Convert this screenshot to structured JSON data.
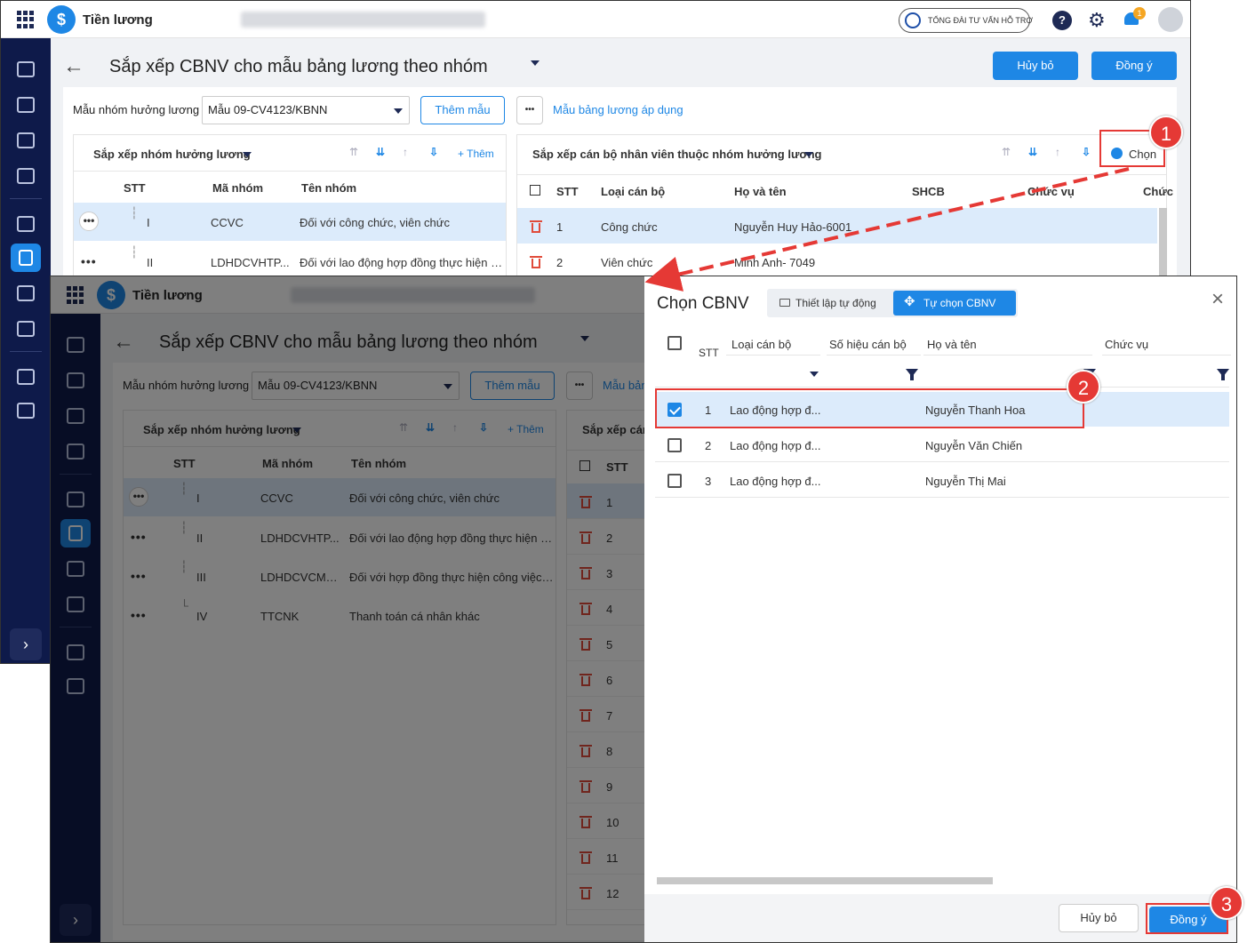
{
  "app": {
    "name": "Tiền lương",
    "support": "TỔNG ĐÀI TƯ VẤN HỖ TRỢ",
    "notification_count": "1"
  },
  "page": {
    "title": "Sắp xếp CBNV cho mẫu bảng lương theo nhóm",
    "cancel": "Hủy bỏ",
    "confirm": "Đồng ý"
  },
  "toolbar": {
    "template_label": "Mẫu nhóm hưởng lương",
    "template_value": "Mẫu 09-CV4123/KBNN",
    "add_template": "Thêm mẫu",
    "more": "•••",
    "applied_link": "Mẫu bảng lương áp dụng"
  },
  "groups": {
    "title": "Sắp xếp nhóm hưởng lương",
    "add": "+ Thêm",
    "columns": [
      "STT",
      "Mã nhóm",
      "Tên nhóm"
    ],
    "rows": [
      {
        "stt": "I",
        "code": "CCVC",
        "name": "Đối với công chức, viên chức"
      },
      {
        "stt": "II",
        "code": "LDHDCVHTP...",
        "name": "Đối với lao động hợp đồng thực hiện c..."
      },
      {
        "stt": "III",
        "code": "LDHDCVCMN...",
        "name": "Đối với hợp đồng thực hiện công việc ..."
      },
      {
        "stt": "IV",
        "code": "TTCNK",
        "name": "Thanh toán cá nhân khác"
      }
    ]
  },
  "staff": {
    "title": "Sắp xếp cán bộ nhân viên thuộc nhóm hưởng lương",
    "title_short": "Sắp xếp cán",
    "choose": "Chọn",
    "columns": [
      "STT",
      "Loại cán bộ",
      "Họ và tên",
      "SHCB",
      "Chức vụ",
      "Chức"
    ],
    "rows": [
      {
        "stt": "1",
        "type": "Công chức",
        "name": "Nguyễn Huy Hảo-6001"
      },
      {
        "stt": "2",
        "type": "Viên chức",
        "name": "Minh Anh- 7049"
      }
    ],
    "numbers": [
      "1",
      "2",
      "3",
      "4",
      "5",
      "6",
      "7",
      "8",
      "9",
      "10",
      "11",
      "12"
    ]
  },
  "dialog": {
    "title": "Chọn CBNV",
    "tab_auto": "Thiết lập tự động",
    "tab_manual": "Tự chọn CBNV",
    "columns": [
      "STT",
      "Loại cán bộ",
      "Số hiệu cán bộ",
      "Họ và tên",
      "Chức vụ"
    ],
    "rows": [
      {
        "stt": "1",
        "type": "Lao động hợp đ...",
        "name": "Nguyễn Thanh Hoa",
        "checked": true
      },
      {
        "stt": "2",
        "type": "Lao động hợp đ...",
        "name": "Nguyễn Văn Chiến",
        "checked": false
      },
      {
        "stt": "3",
        "type": "Lao động hợp đ...",
        "name": "Nguyễn Thị Mai",
        "checked": false
      }
    ],
    "cancel": "Hủy bỏ",
    "confirm": "Đồng ý"
  },
  "steps": [
    "1",
    "2",
    "3"
  ],
  "colors": {
    "primary": "#1e87e5",
    "sidebar": "#0e1a4a",
    "highlight": "#e53935",
    "selected_row": "#dcebfb"
  }
}
